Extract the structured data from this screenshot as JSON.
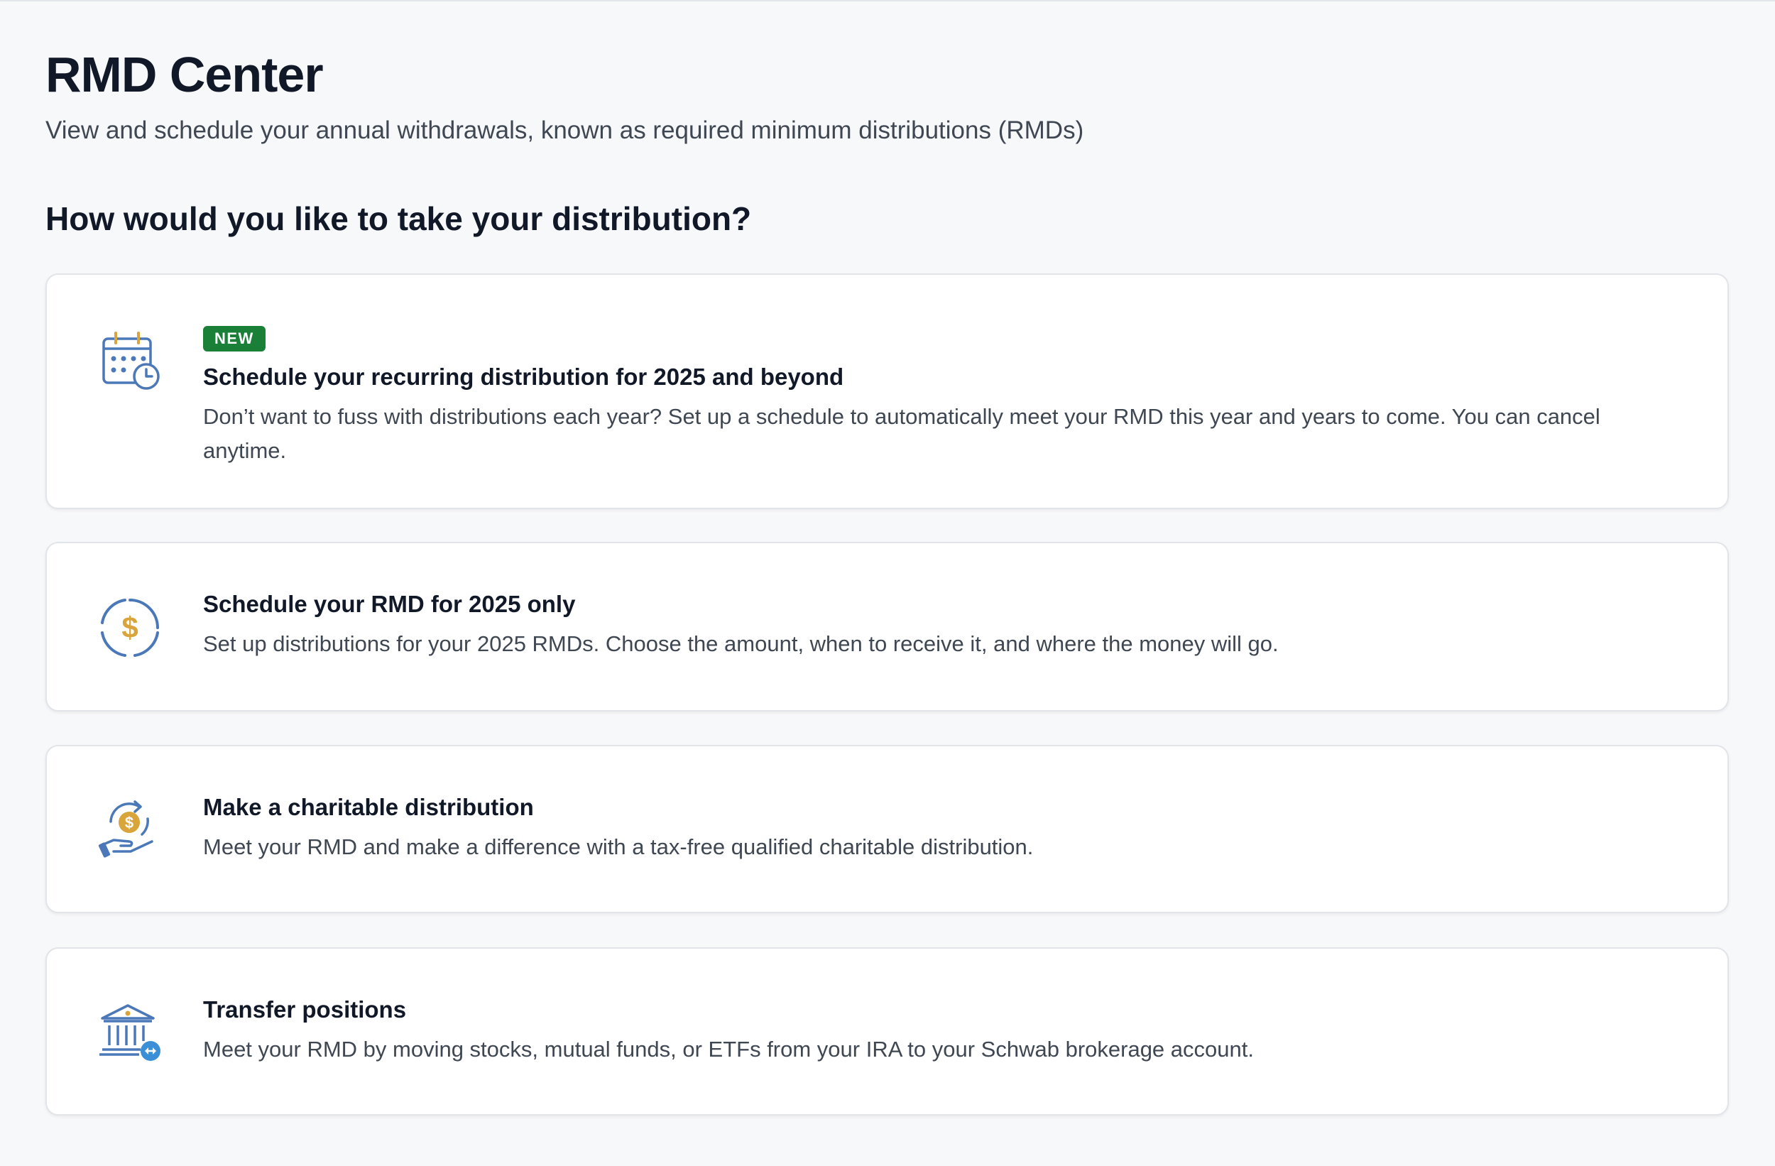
{
  "header": {
    "title": "RMD Center",
    "subtitle": "View and schedule your annual withdrawals, known as required minimum distributions (RMDs)"
  },
  "section": {
    "heading": "How would you like to take your distribution?"
  },
  "options": [
    {
      "icon": "calendar-clock-icon",
      "badge": "NEW",
      "title": "Schedule your recurring distribution for 2025 and beyond",
      "description": "Don’t want to fuss with distributions each year? Set up a schedule to automatically meet your RMD this year and years to come. You can cancel anytime."
    },
    {
      "icon": "dollar-circle-icon",
      "title": "Schedule your RMD for 2025 only",
      "description": "Set up distributions for your 2025 RMDs. Choose the amount, when to receive it, and where the money will go."
    },
    {
      "icon": "charity-hand-icon",
      "title": "Make a charitable distribution",
      "description": "Meet your RMD and make a difference with a tax-free qualified charitable distribution."
    },
    {
      "icon": "bank-transfer-icon",
      "title": "Transfer positions",
      "description": "Meet your RMD by moving stocks, mutual funds, or ETFs from your IRA to your Schwab brokerage account."
    }
  ],
  "colors": {
    "background": "#f7f8fa",
    "card": "#ffffff",
    "badge": "#1a7f37",
    "icon_blue": "#4a78b8",
    "icon_gold": "#d9a53a",
    "text_primary": "#111827",
    "text_secondary": "#3f4752"
  }
}
